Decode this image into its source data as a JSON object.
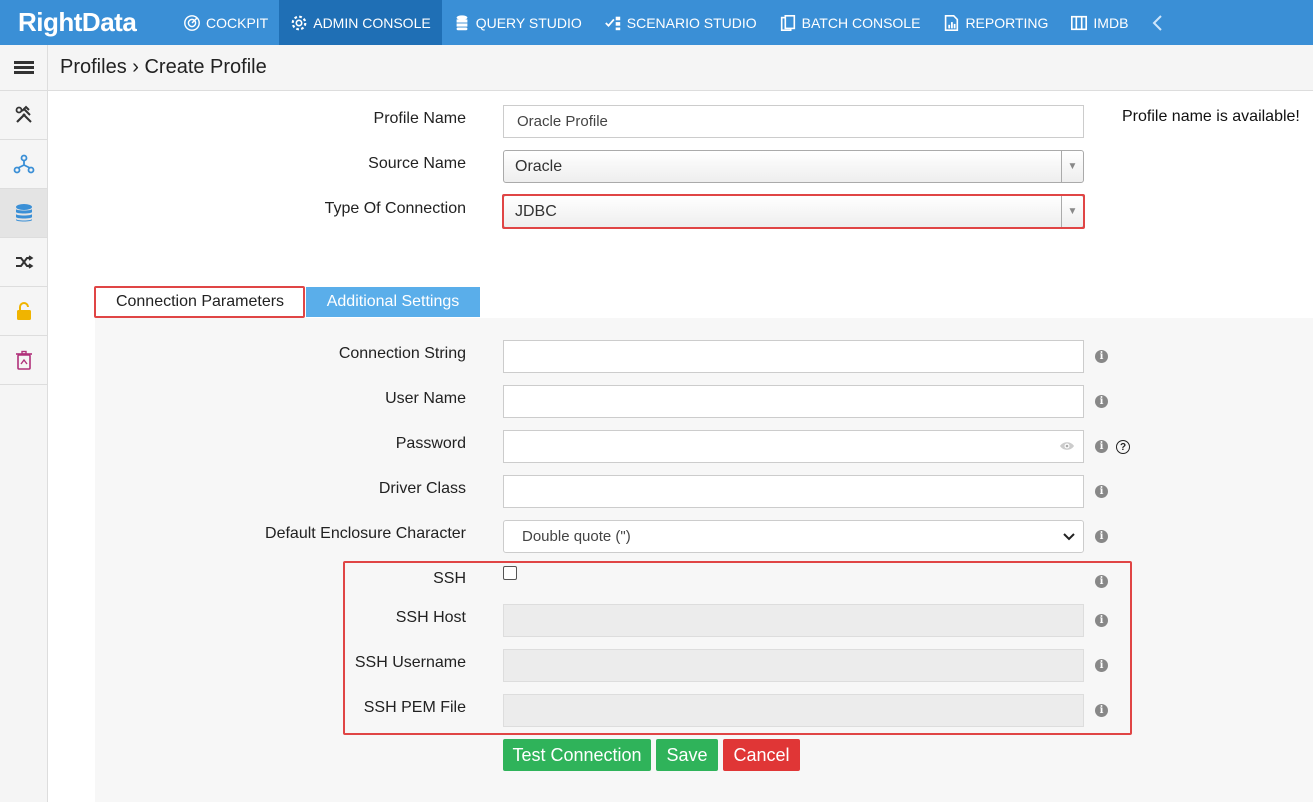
{
  "app": {
    "logo": "RightData"
  },
  "nav": [
    {
      "label": "COCKPIT",
      "icon": "cockpit-icon"
    },
    {
      "label": "ADMIN CONSOLE",
      "icon": "gear-icon",
      "active": true
    },
    {
      "label": "QUERY STUDIO",
      "icon": "database-icon"
    },
    {
      "label": "SCENARIO STUDIO",
      "icon": "scenario-icon"
    },
    {
      "label": "BATCH CONSOLE",
      "icon": "batch-icon"
    },
    {
      "label": "REPORTING",
      "icon": "report-icon"
    },
    {
      "label": "IMDB",
      "icon": "imdb-icon"
    }
  ],
  "breadcrumb": "Profiles › Create Profile",
  "sidebar": [
    "tools-icon",
    "hierarchy-icon",
    "database-icon",
    "shuffle-icon",
    "lock-icon",
    "trash-icon"
  ],
  "form": {
    "profile_name_label": "Profile Name",
    "profile_name_value": "Oracle Profile",
    "profile_status": "Profile name is available!",
    "source_name_label": "Source Name",
    "source_name_value": "Oracle",
    "connection_type_label": "Type Of Connection",
    "connection_type_value": "JDBC"
  },
  "tabs": {
    "connection_parameters": "Connection Parameters",
    "additional_settings": "Additional Settings"
  },
  "params": {
    "connection_string_label": "Connection String",
    "user_name_label": "User Name",
    "password_label": "Password",
    "driver_class_label": "Driver Class",
    "enclosure_label": "Default Enclosure Character",
    "enclosure_value": "Double quote (\")",
    "ssh_label": "SSH",
    "ssh_host_label": "SSH Host",
    "ssh_username_label": "SSH Username",
    "ssh_pem_label": "SSH PEM File",
    "info_glyph": "i",
    "help_glyph": "?"
  },
  "buttons": {
    "test": "Test Connection",
    "save": "Save",
    "cancel": "Cancel"
  },
  "colors": {
    "nav_bg": "#3a8fd6",
    "nav_active": "#1f6fb5",
    "success": "#2fb35a",
    "danger": "#e03636",
    "highlight": "#e04545"
  }
}
